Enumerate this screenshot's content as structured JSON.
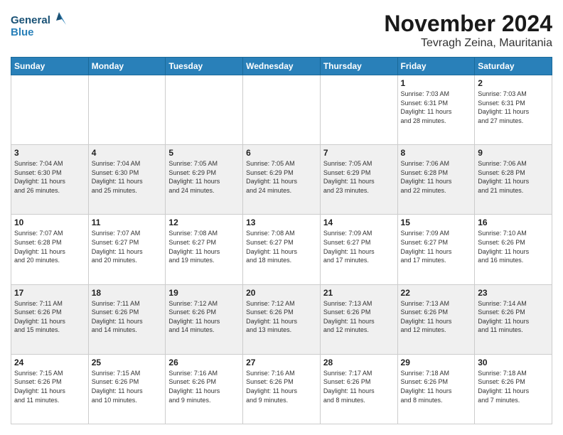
{
  "logo": {
    "line1": "General",
    "line2": "Blue"
  },
  "title": "November 2024",
  "location": "Tevragh Zeina, Mauritania",
  "weekdays": [
    "Sunday",
    "Monday",
    "Tuesday",
    "Wednesday",
    "Thursday",
    "Friday",
    "Saturday"
  ],
  "weeks": [
    [
      {
        "day": "",
        "info": ""
      },
      {
        "day": "",
        "info": ""
      },
      {
        "day": "",
        "info": ""
      },
      {
        "day": "",
        "info": ""
      },
      {
        "day": "",
        "info": ""
      },
      {
        "day": "1",
        "info": "Sunrise: 7:03 AM\nSunset: 6:31 PM\nDaylight: 11 hours\nand 28 minutes."
      },
      {
        "day": "2",
        "info": "Sunrise: 7:03 AM\nSunset: 6:31 PM\nDaylight: 11 hours\nand 27 minutes."
      }
    ],
    [
      {
        "day": "3",
        "info": "Sunrise: 7:04 AM\nSunset: 6:30 PM\nDaylight: 11 hours\nand 26 minutes."
      },
      {
        "day": "4",
        "info": "Sunrise: 7:04 AM\nSunset: 6:30 PM\nDaylight: 11 hours\nand 25 minutes."
      },
      {
        "day": "5",
        "info": "Sunrise: 7:05 AM\nSunset: 6:29 PM\nDaylight: 11 hours\nand 24 minutes."
      },
      {
        "day": "6",
        "info": "Sunrise: 7:05 AM\nSunset: 6:29 PM\nDaylight: 11 hours\nand 24 minutes."
      },
      {
        "day": "7",
        "info": "Sunrise: 7:05 AM\nSunset: 6:29 PM\nDaylight: 11 hours\nand 23 minutes."
      },
      {
        "day": "8",
        "info": "Sunrise: 7:06 AM\nSunset: 6:28 PM\nDaylight: 11 hours\nand 22 minutes."
      },
      {
        "day": "9",
        "info": "Sunrise: 7:06 AM\nSunset: 6:28 PM\nDaylight: 11 hours\nand 21 minutes."
      }
    ],
    [
      {
        "day": "10",
        "info": "Sunrise: 7:07 AM\nSunset: 6:28 PM\nDaylight: 11 hours\nand 20 minutes."
      },
      {
        "day": "11",
        "info": "Sunrise: 7:07 AM\nSunset: 6:27 PM\nDaylight: 11 hours\nand 20 minutes."
      },
      {
        "day": "12",
        "info": "Sunrise: 7:08 AM\nSunset: 6:27 PM\nDaylight: 11 hours\nand 19 minutes."
      },
      {
        "day": "13",
        "info": "Sunrise: 7:08 AM\nSunset: 6:27 PM\nDaylight: 11 hours\nand 18 minutes."
      },
      {
        "day": "14",
        "info": "Sunrise: 7:09 AM\nSunset: 6:27 PM\nDaylight: 11 hours\nand 17 minutes."
      },
      {
        "day": "15",
        "info": "Sunrise: 7:09 AM\nSunset: 6:27 PM\nDaylight: 11 hours\nand 17 minutes."
      },
      {
        "day": "16",
        "info": "Sunrise: 7:10 AM\nSunset: 6:26 PM\nDaylight: 11 hours\nand 16 minutes."
      }
    ],
    [
      {
        "day": "17",
        "info": "Sunrise: 7:11 AM\nSunset: 6:26 PM\nDaylight: 11 hours\nand 15 minutes."
      },
      {
        "day": "18",
        "info": "Sunrise: 7:11 AM\nSunset: 6:26 PM\nDaylight: 11 hours\nand 14 minutes."
      },
      {
        "day": "19",
        "info": "Sunrise: 7:12 AM\nSunset: 6:26 PM\nDaylight: 11 hours\nand 14 minutes."
      },
      {
        "day": "20",
        "info": "Sunrise: 7:12 AM\nSunset: 6:26 PM\nDaylight: 11 hours\nand 13 minutes."
      },
      {
        "day": "21",
        "info": "Sunrise: 7:13 AM\nSunset: 6:26 PM\nDaylight: 11 hours\nand 12 minutes."
      },
      {
        "day": "22",
        "info": "Sunrise: 7:13 AM\nSunset: 6:26 PM\nDaylight: 11 hours\nand 12 minutes."
      },
      {
        "day": "23",
        "info": "Sunrise: 7:14 AM\nSunset: 6:26 PM\nDaylight: 11 hours\nand 11 minutes."
      }
    ],
    [
      {
        "day": "24",
        "info": "Sunrise: 7:15 AM\nSunset: 6:26 PM\nDaylight: 11 hours\nand 11 minutes."
      },
      {
        "day": "25",
        "info": "Sunrise: 7:15 AM\nSunset: 6:26 PM\nDaylight: 11 hours\nand 10 minutes."
      },
      {
        "day": "26",
        "info": "Sunrise: 7:16 AM\nSunset: 6:26 PM\nDaylight: 11 hours\nand 9 minutes."
      },
      {
        "day": "27",
        "info": "Sunrise: 7:16 AM\nSunset: 6:26 PM\nDaylight: 11 hours\nand 9 minutes."
      },
      {
        "day": "28",
        "info": "Sunrise: 7:17 AM\nSunset: 6:26 PM\nDaylight: 11 hours\nand 8 minutes."
      },
      {
        "day": "29",
        "info": "Sunrise: 7:18 AM\nSunset: 6:26 PM\nDaylight: 11 hours\nand 8 minutes."
      },
      {
        "day": "30",
        "info": "Sunrise: 7:18 AM\nSunset: 6:26 PM\nDaylight: 11 hours\nand 7 minutes."
      }
    ]
  ]
}
